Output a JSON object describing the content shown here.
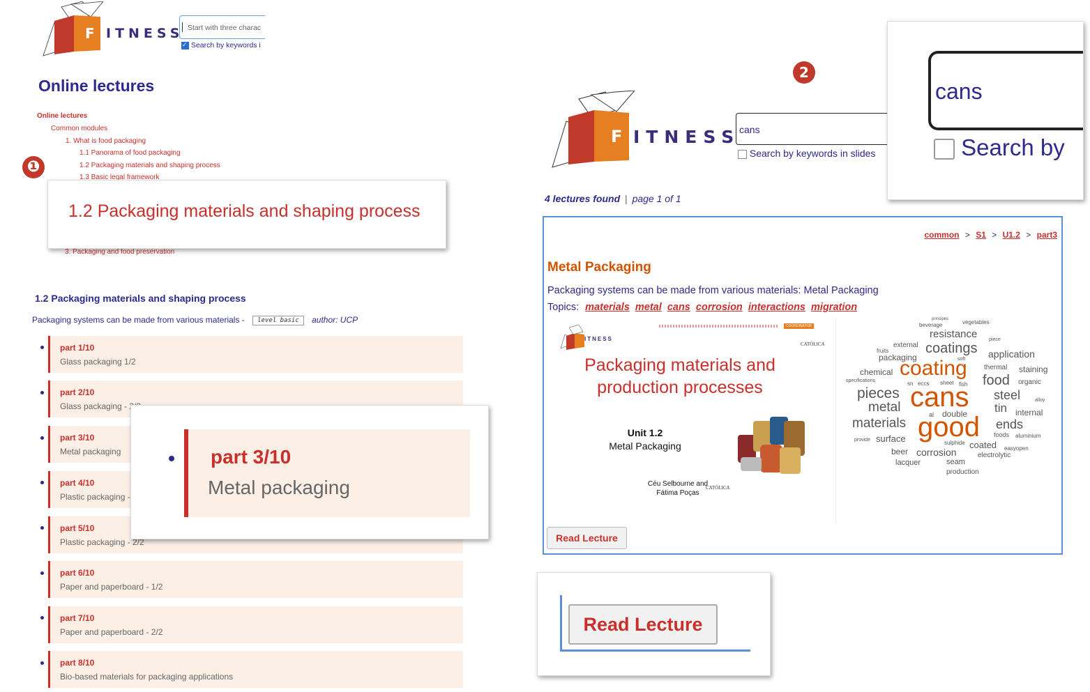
{
  "left": {
    "logo_word": "ITNESS",
    "logo_letter": "F",
    "search_placeholder": "Start with three charac",
    "search_keywords_label": "Search by keywords i",
    "page_title": "Online lectures",
    "toc": [
      "Online lectures",
      "Common modules",
      "1. What is food packaging",
      "1.1 Panorama of food packaging",
      "1.2 Packaging materials and shaping process",
      "1.3 Basic legal framework",
      "3. Packaging and food preservation"
    ],
    "callout1_text": "1.2 Packaging materials and shaping process",
    "section_title": "1.2 Packaging materials and shaping process",
    "section_desc": "Packaging systems can be made from various materials -",
    "level_tag": "level basic",
    "author": "author: UCP",
    "parts": [
      {
        "title": "part 1/10",
        "sub": "Glass packaging 1/2"
      },
      {
        "title": "part 2/10",
        "sub": "Glass packaging - 2/2"
      },
      {
        "title": "part 3/10",
        "sub": "Metal packaging"
      },
      {
        "title": "part 4/10",
        "sub": "Plastic packaging - 1/2"
      },
      {
        "title": "part 5/10",
        "sub": "Plastic packaging - 2/2"
      },
      {
        "title": "part 6/10",
        "sub": "Paper and paperboard - 1/2"
      },
      {
        "title": "part 7/10",
        "sub": "Paper and paperboard - 2/2"
      },
      {
        "title": "part 8/10",
        "sub": "Bio-based materials for packaging applications"
      }
    ],
    "callout3_title": "part 3/10",
    "callout3_sub": "Metal packaging"
  },
  "badges": {
    "one": "❶",
    "two": "2"
  },
  "right": {
    "search_value": "cans",
    "search_keywords_label": "Search by keywords in slides",
    "zoom_value": "cans",
    "zoom_label": "Search by",
    "results_count": "4 lectures found",
    "results_page": "page  1 of 1",
    "breadcrumb": [
      "common",
      "S1",
      "U1.2",
      "part3"
    ],
    "breadcrumb_sep": ">",
    "result_title": "Metal Packaging",
    "result_desc": "Packaging systems can be made from various materials: Metal Packaging",
    "topics_label": "Topics:",
    "topics": [
      "materials",
      "metal",
      "cans",
      "corrosion",
      "interactions",
      "migration"
    ],
    "slide": {
      "title_line1": "Packaging materials and",
      "title_line2": "production processes",
      "unit": "Unit 1.2",
      "unit_sub": "Metal Packaging",
      "authors_line1": "Céu Selbourne and",
      "authors_line2": "Fátima Poças",
      "logo_word": "ITNESS",
      "univ": "CATÓLICA",
      "coordinator": "COORDINATOR"
    },
    "read_button": "Read Lecture",
    "zoom_read_button": "Read Lecture"
  },
  "wordcloud": [
    {
      "t": "cans",
      "c": "#d35400",
      "s": 40
    },
    {
      "t": "good",
      "c": "#d35400",
      "s": 40
    },
    {
      "t": "coating",
      "c": "#d35400",
      "s": 30
    },
    {
      "t": "coatings",
      "c": "#555555",
      "s": 20
    },
    {
      "t": "pieces",
      "c": "#555555",
      "s": 21
    },
    {
      "t": "metal",
      "c": "#555555",
      "s": 19
    },
    {
      "t": "materials",
      "c": "#555555",
      "s": 19
    },
    {
      "t": "food",
      "c": "#555555",
      "s": 20
    },
    {
      "t": "steel",
      "c": "#555555",
      "s": 18
    },
    {
      "t": "ends",
      "c": "#555555",
      "s": 18
    },
    {
      "t": "tin",
      "c": "#555555",
      "s": 17
    },
    {
      "t": "resistance",
      "c": "#555555",
      "s": 15
    },
    {
      "t": "application",
      "c": "#555555",
      "s": 14
    },
    {
      "t": "surface",
      "c": "#555555",
      "s": 13
    },
    {
      "t": "corrosion",
      "c": "#555555",
      "s": 14
    },
    {
      "t": "coated",
      "c": "#555555",
      "s": 13
    },
    {
      "t": "packaging",
      "c": "#555555",
      "s": 12
    },
    {
      "t": "chemical",
      "c": "#555555",
      "s": 12
    },
    {
      "t": "staining",
      "c": "#555555",
      "s": 12
    },
    {
      "t": "internal",
      "c": "#555555",
      "s": 12
    },
    {
      "t": "double",
      "c": "#555555",
      "s": 12
    },
    {
      "t": "beer",
      "c": "#555555",
      "s": 12
    },
    {
      "t": "seam",
      "c": "#555555",
      "s": 11
    },
    {
      "t": "lacquer",
      "c": "#555555",
      "s": 11
    },
    {
      "t": "external",
      "c": "#555555",
      "s": 10
    },
    {
      "t": "thermal",
      "c": "#555555",
      "s": 10
    },
    {
      "t": "foods",
      "c": "#555555",
      "s": 9
    },
    {
      "t": "electrolytic",
      "c": "#555555",
      "s": 10
    },
    {
      "t": "production",
      "c": "#555555",
      "s": 10
    },
    {
      "t": "organic",
      "c": "#555555",
      "s": 10
    },
    {
      "t": "beverage",
      "c": "#555555",
      "s": 8
    },
    {
      "t": "vegetables",
      "c": "#555555",
      "s": 8
    },
    {
      "t": "fruits",
      "c": "#555555",
      "s": 8
    },
    {
      "t": "sheet",
      "c": "#555555",
      "s": 8
    },
    {
      "t": "fish",
      "c": "#555555",
      "s": 8
    },
    {
      "t": "aluminium",
      "c": "#555555",
      "s": 8
    },
    {
      "t": "easyopen",
      "c": "#555555",
      "s": 8
    },
    {
      "t": "sulphide",
      "c": "#555555",
      "s": 8
    },
    {
      "t": "provide",
      "c": "#555555",
      "s": 7
    },
    {
      "t": "specifications",
      "c": "#555555",
      "s": 7
    },
    {
      "t": "soft",
      "c": "#555555",
      "s": 7
    },
    {
      "t": "alloy",
      "c": "#555555",
      "s": 7
    },
    {
      "t": "piece",
      "c": "#555555",
      "s": 7
    },
    {
      "t": "principes",
      "c": "#555555",
      "s": 6
    },
    {
      "t": "al",
      "c": "#555555",
      "s": 9
    },
    {
      "t": "sn",
      "c": "#555555",
      "s": 8
    },
    {
      "t": "eccs",
      "c": "#555555",
      "s": 8
    }
  ],
  "colors": {
    "accent_red": "#c9302c",
    "navy": "#2d2a8c",
    "orange": "#d35400",
    "blue_border": "#5b8fd6"
  }
}
